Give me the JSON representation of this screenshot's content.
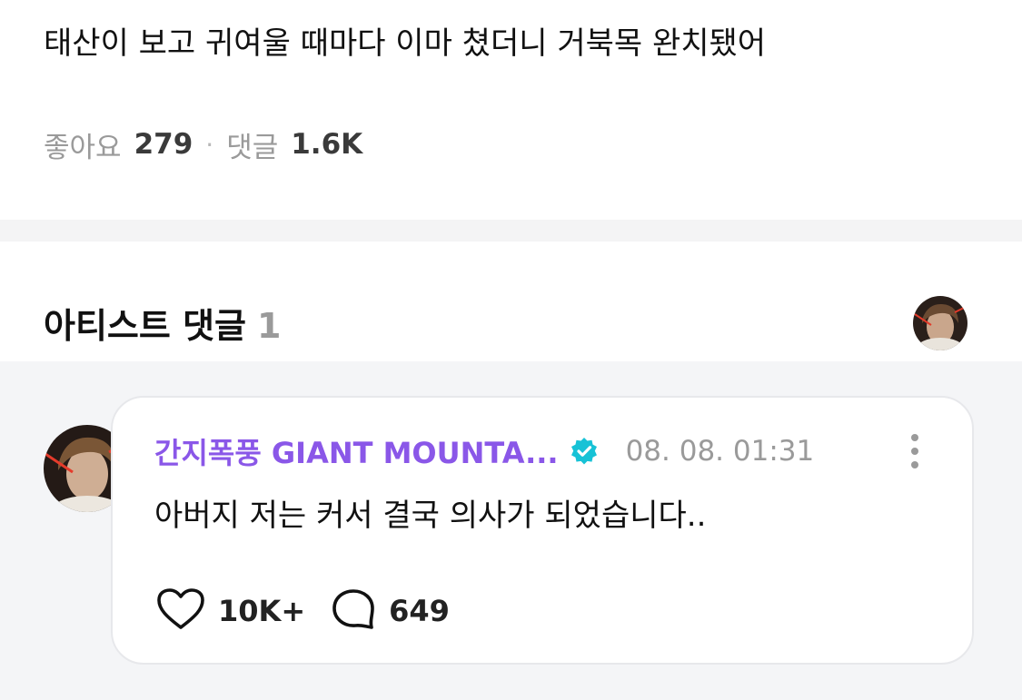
{
  "post": {
    "text": "태산이 보고 귀여울 때마다 이마 쳤더니 거북목 완치됐어",
    "likes_label": "좋아요",
    "likes_count": "279",
    "separator": "·",
    "comments_label": "댓글",
    "comments_count": "1.6K"
  },
  "artist_section": {
    "title": "아티스트 댓글",
    "count": "1"
  },
  "comment": {
    "author": "간지폭풍 GIANT MOUNTA...",
    "timestamp": "08. 08. 01:31",
    "text": "아버지 저는 커서 결국 의사가 되었습니다..",
    "like_count": "10K+",
    "reply_count": "649"
  },
  "colors": {
    "author_accent": "#8a57e8",
    "verified_badge": "#17c2d6",
    "section_background": "#f4f5f7"
  },
  "icons": {
    "verified": "verified-badge-icon",
    "more": "more-vertical-icon",
    "like": "heart-icon",
    "reply": "speech-bubble-icon"
  }
}
